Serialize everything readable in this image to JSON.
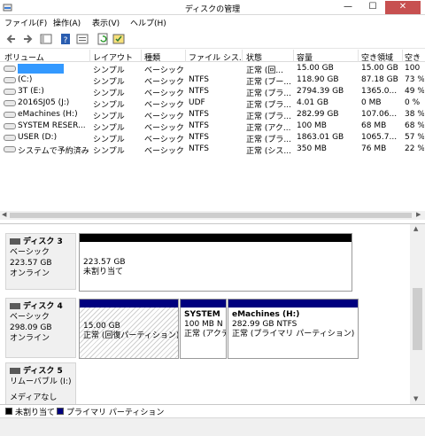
{
  "window": {
    "title": "ディスクの管理"
  },
  "menu": {
    "file": "ファイル(F)",
    "action": "操作(A)",
    "view": "表示(V)",
    "help": "ヘルプ(H)"
  },
  "columns": {
    "volume": "ボリューム",
    "layout": "レイアウト",
    "type": "種類",
    "fs": "ファイル シス...",
    "status": "状態",
    "capacity": "容量",
    "free": "空き領域",
    "pct": "空き"
  },
  "volumes": [
    {
      "name": "",
      "layout": "シンプル",
      "type": "ベーシック",
      "fs": "",
      "status": "正常 (回...",
      "capacity": "15.00 GB",
      "free": "15.00 GB",
      "pct": "100"
    },
    {
      "name": "(C:)",
      "layout": "シンプル",
      "type": "ベーシック",
      "fs": "NTFS",
      "status": "正常 (ブー...",
      "capacity": "118.90 GB",
      "free": "87.18 GB",
      "pct": "73 %"
    },
    {
      "name": "3T (E:)",
      "layout": "シンプル",
      "type": "ベーシック",
      "fs": "NTFS",
      "status": "正常 (プラ...",
      "capacity": "2794.39 GB",
      "free": "1365.0...",
      "pct": "49 %"
    },
    {
      "name": "2016SJ05 (J:)",
      "layout": "シンプル",
      "type": "ベーシック",
      "fs": "UDF",
      "status": "正常 (プラ...",
      "capacity": "4.01 GB",
      "free": "0 MB",
      "pct": "0 %"
    },
    {
      "name": "eMachines (H:)",
      "layout": "シンプル",
      "type": "ベーシック",
      "fs": "NTFS",
      "status": "正常 (プラ...",
      "capacity": "282.99 GB",
      "free": "107.06...",
      "pct": "38 %"
    },
    {
      "name": "SYSTEM RESER...",
      "layout": "シンプル",
      "type": "ベーシック",
      "fs": "NTFS",
      "status": "正常 (アク...",
      "capacity": "100 MB",
      "free": "68 MB",
      "pct": "68 %"
    },
    {
      "name": "USER (D:)",
      "layout": "シンプル",
      "type": "ベーシック",
      "fs": "NTFS",
      "status": "正常 (プラ...",
      "capacity": "1863.01 GB",
      "free": "1065.7...",
      "pct": "57 %"
    },
    {
      "name": "システムで予約済み",
      "layout": "シンプル",
      "type": "ベーシック",
      "fs": "NTFS",
      "status": "正常 (シス...",
      "capacity": "350 MB",
      "free": "76 MB",
      "pct": "22 %"
    }
  ],
  "disks": [
    {
      "name": "ディスク 3",
      "kind": "ベーシック",
      "size": "223.57 GB",
      "state": "オンライン",
      "partitions": [
        {
          "size": "223.57 GB",
          "status": "未割り当て"
        }
      ]
    },
    {
      "name": "ディスク 4",
      "kind": "ベーシック",
      "size": "298.09 GB",
      "state": "オンライン",
      "partitions": [
        {
          "title": "",
          "size": "15.00 GB",
          "status": "正常 (回復パーティション)"
        },
        {
          "title": "SYSTEM",
          "size": "100 MB N",
          "status": "正常 (アクテ"
        },
        {
          "title": "eMachines  (H:)",
          "size": "282.99 GB NTFS",
          "status": "正常 (プライマリ パーティション)"
        }
      ]
    },
    {
      "name": "ディスク 5",
      "kind": "リムーバブル (I:)",
      "size": "",
      "state": "メディアなし",
      "partitions": []
    }
  ],
  "legend": {
    "unallocated": "未割り当て",
    "primary": "プライマリ パーティション"
  },
  "colors": {
    "unallocated": "#000000",
    "primary": "#00007f",
    "close": "#c75050"
  }
}
